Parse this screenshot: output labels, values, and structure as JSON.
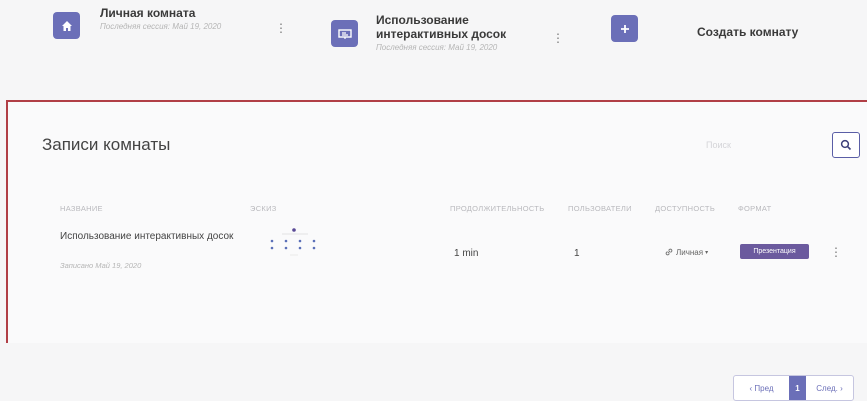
{
  "rooms": [
    {
      "title": "Личная комната",
      "subtitle": "Последняя сессия: Май 19, 2020",
      "icon": "home-icon"
    },
    {
      "title_line1": "Использование",
      "title_line2": "интерактивных досок",
      "subtitle": "Последняя сессия: Май 19, 2020",
      "icon": "presentation-icon"
    }
  ],
  "create": {
    "label": "Создать комнату",
    "icon": "plus-icon"
  },
  "recordings": {
    "title": "Записи комнаты",
    "search_placeholder": "Поиск",
    "columns": [
      "НАЗВАНИЕ",
      "ЭСКИЗ",
      "ПРОДОЛЖИТЕЛЬНОСТЬ",
      "ПОЛЬЗОВАТЕЛИ",
      "ДОСТУПНОСТЬ",
      "ФОРМАТ"
    ],
    "row": {
      "name": "Использование интерактивных досок",
      "recorded": "Записано Май 19, 2020",
      "duration": "1 min",
      "users": "1",
      "access": "Личная",
      "format": "Презентация"
    },
    "pagination": {
      "prev": "‹ Пред",
      "current": "1",
      "next": "След. ›"
    }
  },
  "colors": {
    "accent": "#6b6fb8",
    "panel_border": "#b13f46",
    "badge": "#6b5a9e"
  }
}
